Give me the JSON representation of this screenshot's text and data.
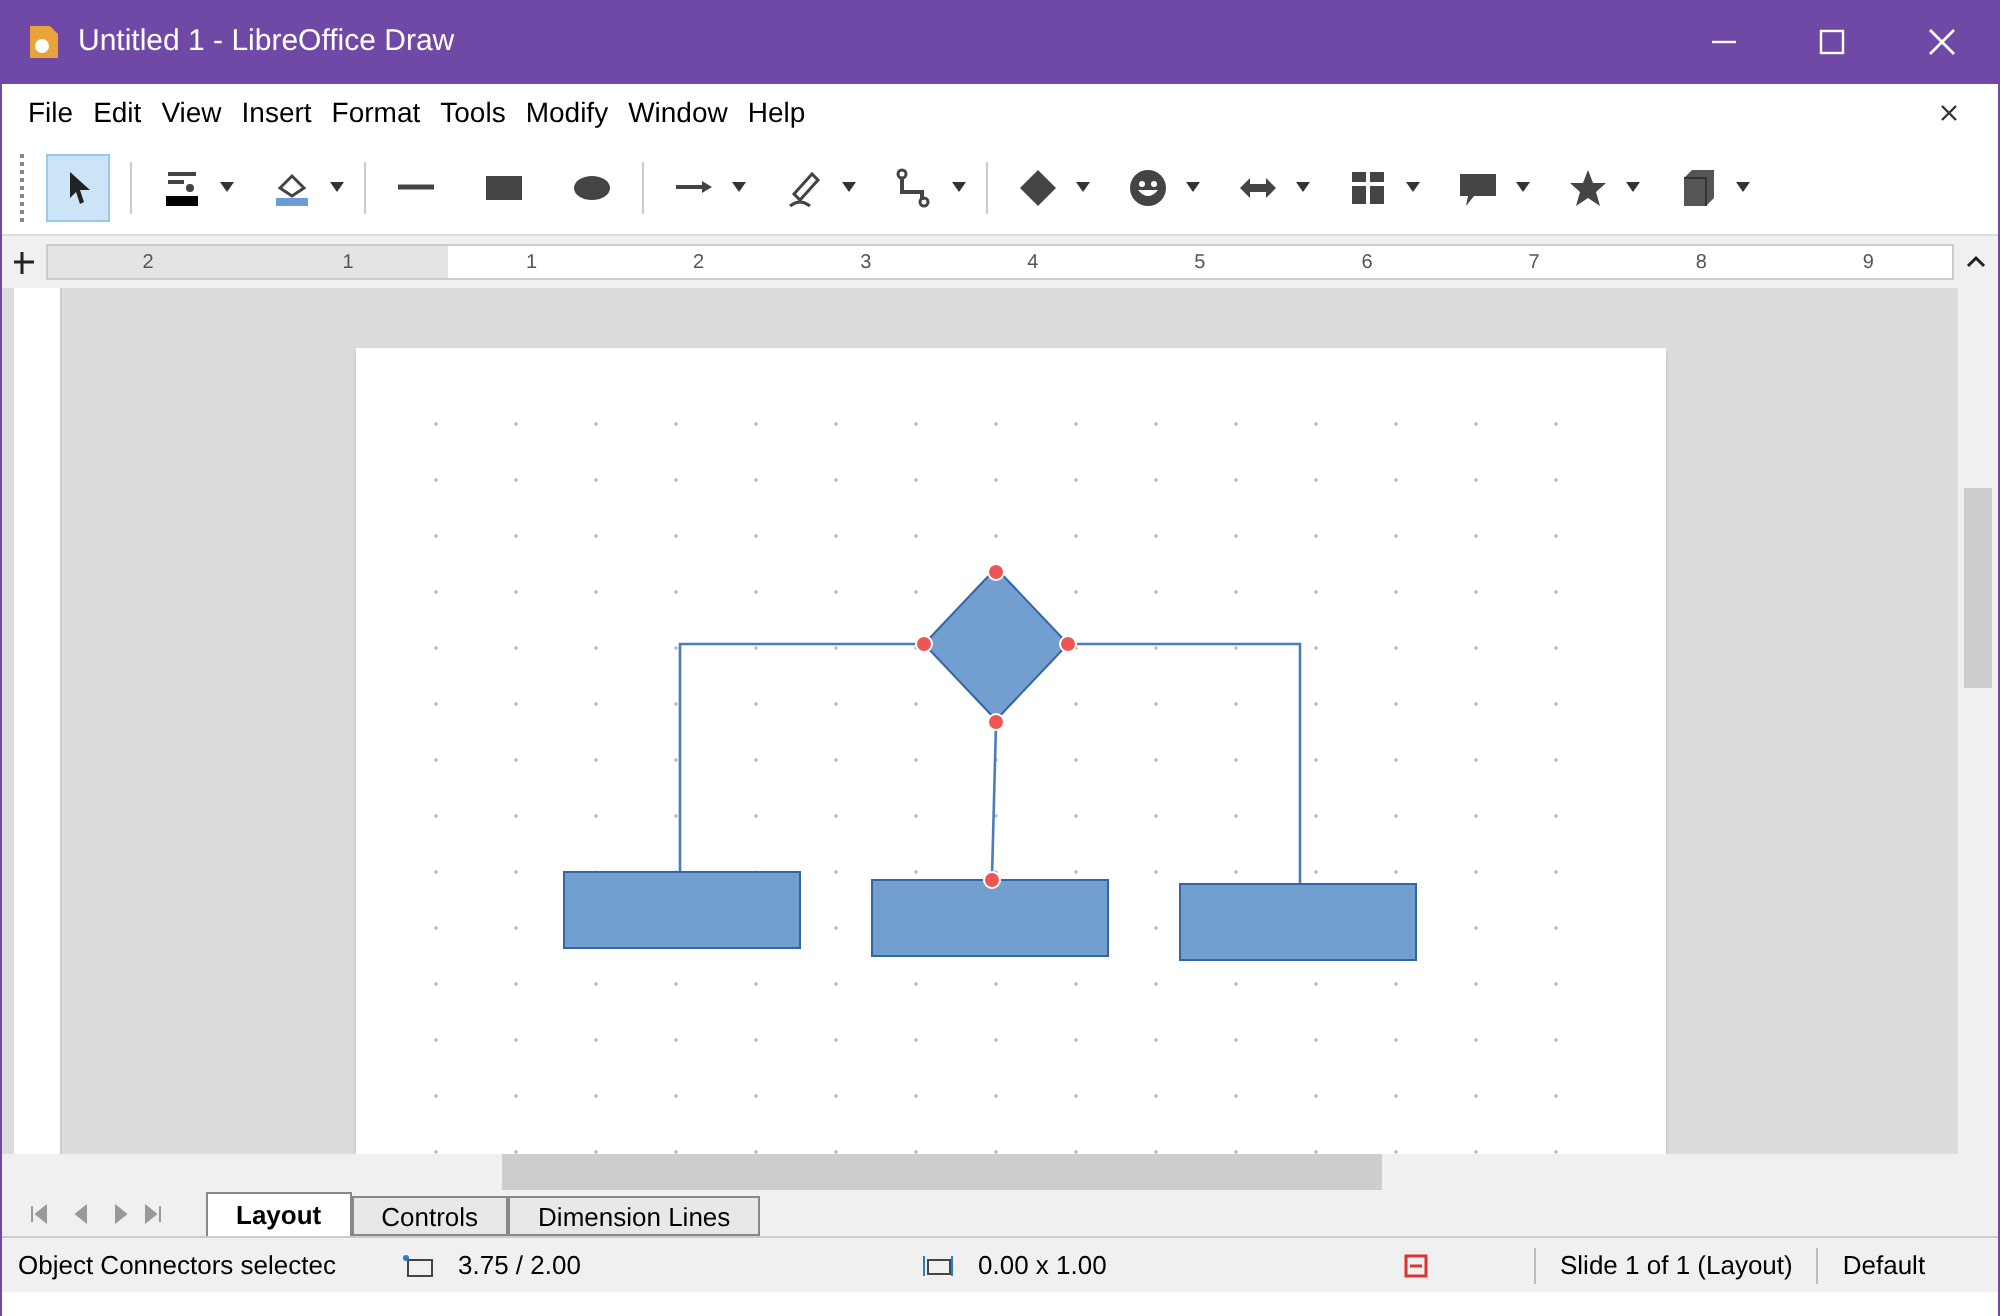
{
  "window": {
    "title": "Untitled 1 - LibreOffice Draw"
  },
  "menu": [
    "File",
    "Edit",
    "View",
    "Insert",
    "Format",
    "Tools",
    "Modify",
    "Window",
    "Help"
  ],
  "toolbar": [
    {
      "kind": "select",
      "selected": true,
      "dropdown": false
    },
    {
      "kind": "line-color",
      "selected": false,
      "dropdown": true
    },
    {
      "kind": "fill-color",
      "selected": false,
      "dropdown": true
    },
    {
      "kind": "line",
      "selected": false,
      "dropdown": false
    },
    {
      "kind": "rect",
      "selected": false,
      "dropdown": false
    },
    {
      "kind": "ellipse",
      "selected": false,
      "dropdown": false
    },
    {
      "kind": "arrow",
      "selected": false,
      "dropdown": true
    },
    {
      "kind": "pen",
      "selected": false,
      "dropdown": true
    },
    {
      "kind": "connector",
      "selected": false,
      "dropdown": true
    },
    {
      "kind": "diamond",
      "selected": false,
      "dropdown": true
    },
    {
      "kind": "smiley",
      "selected": false,
      "dropdown": true
    },
    {
      "kind": "double-arrow",
      "selected": false,
      "dropdown": true
    },
    {
      "kind": "flowchart",
      "selected": false,
      "dropdown": true
    },
    {
      "kind": "callout",
      "selected": false,
      "dropdown": true
    },
    {
      "kind": "star",
      "selected": false,
      "dropdown": true
    },
    {
      "kind": "cube",
      "selected": false,
      "dropdown": true
    }
  ],
  "ruler": {
    "labels": [
      "2",
      "1",
      "1",
      "2",
      "3",
      "4",
      "5",
      "6",
      "7",
      "8",
      "9"
    ]
  },
  "tabs": [
    {
      "label": "Layout",
      "selected": true
    },
    {
      "label": "Controls",
      "selected": false
    },
    {
      "label": "Dimension Lines",
      "selected": false
    }
  ],
  "status_bar": {
    "message": "Object Connectors selectec",
    "position": "3.75 / 2.00",
    "size": "0.00 x 1.00",
    "slide": "Slide 1 of 1 (Layout)",
    "style": "Default"
  }
}
